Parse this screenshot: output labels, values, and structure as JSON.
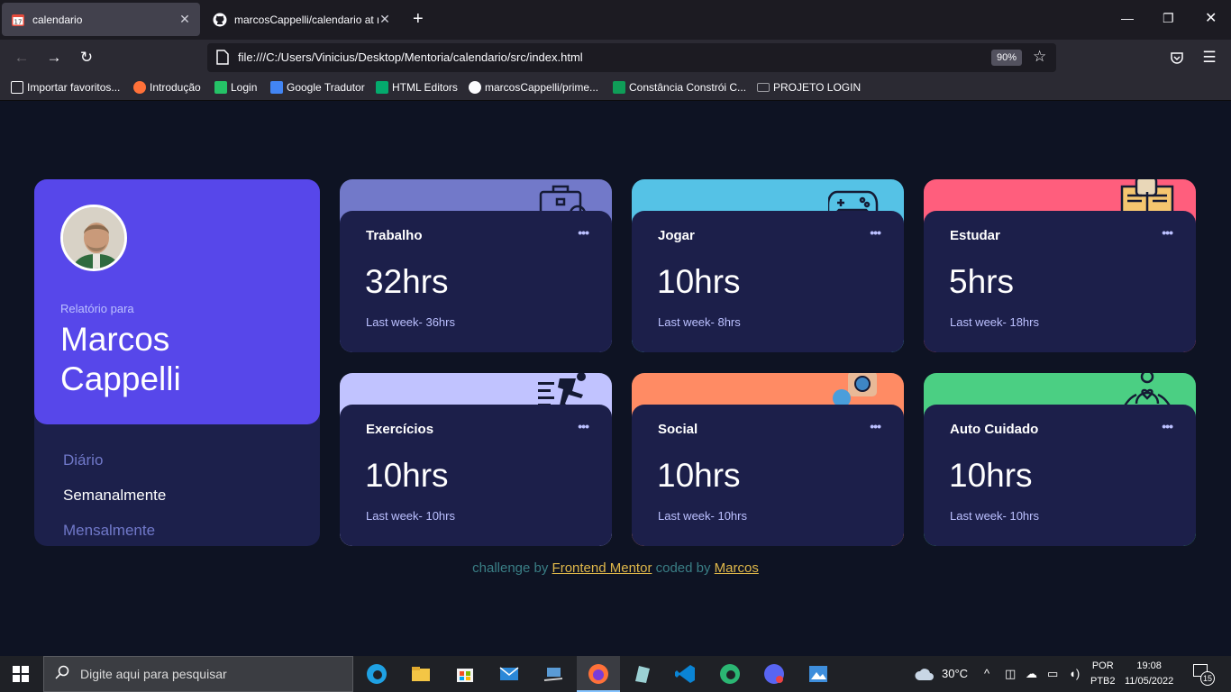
{
  "browser": {
    "tabs": [
      {
        "title": "calendario",
        "active": true
      },
      {
        "title": "marcosCappelli/calendario at m",
        "active": false
      }
    ],
    "url": "file:///C:/Users/Vinicius/Desktop/Mentoria/calendario/src/index.html",
    "zoom": "90%",
    "bookmarks": [
      "Importar favoritos...",
      "Introdução",
      "Login",
      "Google Tradutor",
      "HTML Editors",
      "marcosCappelli/prime...",
      "Constância Constrói C...",
      "PROJETO LOGIN"
    ]
  },
  "profile": {
    "report_for": "Relatório para",
    "name": "Marcos Cappelli",
    "periods": [
      "Diário",
      "Semanalmente",
      "Mensalmente"
    ],
    "selected_period": "Semanalmente"
  },
  "cards": [
    {
      "title": "Trabalho",
      "hours": "32hrs",
      "last": "Last week- 36hrs",
      "color": "#7279c9",
      "icon": "briefcase-icon",
      "menu": "•••"
    },
    {
      "title": "Jogar",
      "hours": "10hrs",
      "last": "Last week- 8hrs",
      "color": "#55c2e6",
      "icon": "gamepad-icon",
      "menu": "•••"
    },
    {
      "title": "Estudar",
      "hours": "5hrs",
      "last": "Last week- 18hrs",
      "color": "#ff5e7d",
      "icon": "book-icon",
      "menu": "•••"
    },
    {
      "title": "Exercícios",
      "hours": "10hrs",
      "last": "Last week- 10hrs",
      "color": "#c1c3ff",
      "icon": "runner-icon",
      "menu": "•••"
    },
    {
      "title": "Social",
      "hours": "10hrs",
      "last": "Last week- 10hrs",
      "color": "#ff8b64",
      "icon": "social-icon",
      "menu": "•••"
    },
    {
      "title": "Auto Cuidado",
      "hours": "10hrs",
      "last": "Last week- 10hrs",
      "color": "#4bcf83",
      "icon": "meditation-icon",
      "menu": "•••"
    }
  ],
  "attribution": {
    "prefix": "challenge by",
    "link1": "Frontend Mentor",
    "middle": "coded by",
    "link2": "Marcos"
  },
  "taskbar": {
    "search_placeholder": "Digite aqui para pesquisar",
    "weather": "30°C",
    "lang_top": "POR",
    "lang_bottom": "PTB2",
    "time": "19:08",
    "date": "11/05/2022",
    "notifications": "15"
  }
}
